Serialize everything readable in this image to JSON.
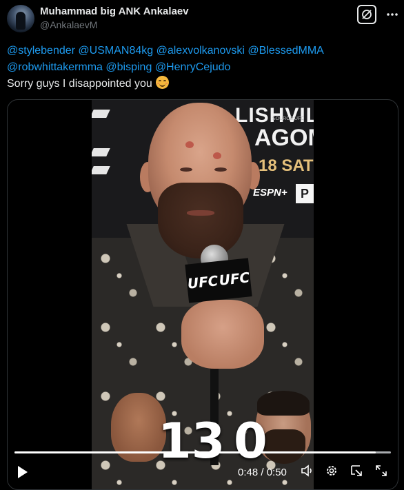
{
  "author": {
    "display_name": "Muhammad big ANK Ankalaev",
    "handle": "@AnkalaevM"
  },
  "toolbar": {
    "grok_icon": "grok-icon",
    "more_icon": "more-dots-icon"
  },
  "tweet": {
    "mentions": [
      "@stylebender",
      "@USMAN84kg",
      "@alexvolkanovski",
      "@BlessedMMA",
      "@robwhittakermma",
      "@bisping",
      "@HenryCejudo"
    ],
    "text": "Sorry guys I disappointed you",
    "emoji": "smiling-face-emoji"
  },
  "video": {
    "backdrop": {
      "line1": "LISHVILI",
      "line2": "AGOMEI",
      "line3": "18 SAT",
      "network": "ESPN+",
      "box": "P",
      "source": "SOURCE:UFC"
    },
    "mic_labels": [
      "UFC",
      "UFC"
    ],
    "score_left": "13",
    "score_right": "0",
    "progress": 0.96,
    "time_display": "0:48 / 0:50"
  },
  "colors": {
    "background": "#000000",
    "text": "#e7e9ea",
    "secondary_text": "#71767b",
    "link": "#1d9bf0",
    "border": "#2f3336"
  }
}
